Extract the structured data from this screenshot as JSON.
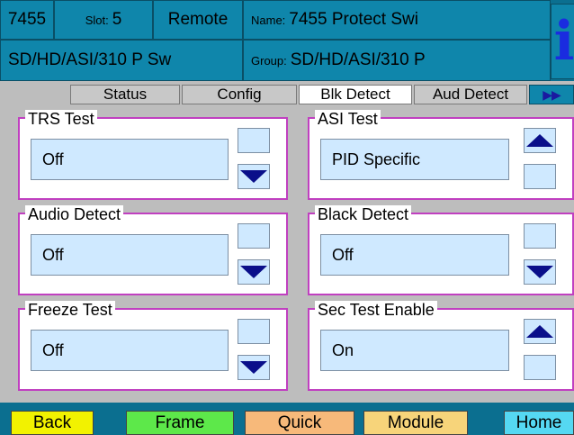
{
  "header": {
    "id": "7455",
    "slot_label": "Slot:",
    "slot_value": "5",
    "mode": "Remote",
    "name_label": "Name:",
    "name_value": "7455 Protect Swi",
    "subtitle": "SD/HD/ASI/310 P Sw",
    "group_label": "Group:",
    "group_value": "SD/HD/ASI/310 P",
    "info_glyph": "i"
  },
  "tabs": [
    {
      "label": "Status"
    },
    {
      "label": "Config"
    },
    {
      "label": "Blk Detect",
      "active": true
    },
    {
      "label": "Aud Detect"
    },
    {
      "label": "▶▶"
    }
  ],
  "panels": [
    {
      "title": "TRS Test",
      "value": "Off",
      "stepper": "down"
    },
    {
      "title": "ASI Test",
      "value": "PID Specific",
      "stepper": "up"
    },
    {
      "title": "Audio Detect",
      "value": "Off",
      "stepper": "down"
    },
    {
      "title": "Black Detect",
      "value": "Off",
      "stepper": "down"
    },
    {
      "title": "Freeze Test",
      "value": "Off",
      "stepper": "down"
    },
    {
      "title": "Sec Test Enable",
      "value": "On",
      "stepper": "up"
    }
  ],
  "nav": {
    "back": "Back",
    "frame": "Frame",
    "quick": "Quick",
    "module": "Module",
    "home": "Home"
  },
  "colors": {
    "header_bg": "#0b6f90",
    "panel_border": "#c040c0",
    "field_bg": "#cfe9ff",
    "arrow": "#0a0f8a",
    "back_btn": "#f2f200",
    "frame_btn": "#5de84a",
    "quick_btn": "#f7b97a",
    "module_btn": "#f7d47a",
    "home_btn": "#55d8f2"
  }
}
